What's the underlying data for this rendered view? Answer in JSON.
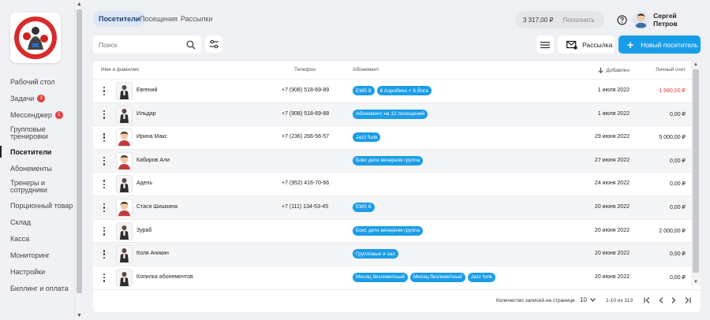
{
  "sidebar": {
    "items": [
      {
        "label": "Рабочий стол"
      },
      {
        "label": "Задачи",
        "badge": "3"
      },
      {
        "label": "Мессенджер",
        "badge": "1"
      },
      {
        "label": "Групповые тренировки"
      },
      {
        "label": "Посетители",
        "active": true
      },
      {
        "label": "Абонементы"
      },
      {
        "label": "Тренеры и сотрудники"
      },
      {
        "label": "Порционный товар"
      },
      {
        "label": "Склад"
      },
      {
        "label": "Касса"
      },
      {
        "label": "Мониторинг"
      },
      {
        "label": "Настройки"
      },
      {
        "label": "Биллинг и оплата"
      }
    ]
  },
  "topbar": {
    "tabs": [
      {
        "label": "Посетители",
        "active": true
      },
      {
        "label": "Посещения"
      },
      {
        "label": "Рассылки"
      }
    ],
    "balance": "3 317,00 ₽",
    "replenish_label": "Пополнить",
    "user_name": "Сергей Петров"
  },
  "toolbar": {
    "search_placeholder": "Поиск",
    "mailing_label": "Рассылка",
    "new_visitor_label": "Новый посетитель"
  },
  "table": {
    "columns": {
      "name": "Имя и фамилия",
      "phone": "Телефон",
      "subscription": "Абонемент",
      "added": "Добавлен",
      "balance": "Личный счет"
    },
    "rows": [
      {
        "name": "Евгений",
        "avatar": "photo",
        "phone": "+7 (908) 518-69-89",
        "subs": [
          "EMS 8",
          "8 Аэробика + 8 Йога"
        ],
        "added": "1 июля 2022",
        "balance": "-1 980,00 ₽",
        "negative": true
      },
      {
        "name": "Ильдар",
        "avatar": "photo",
        "phone": "+7 (908) 518-69-88",
        "subs": [
          "Абонемент на 12 посещений"
        ],
        "added": "1 июля 2022",
        "balance": "0,00 ₽"
      },
      {
        "name": "Ирина Макс",
        "avatar": "cartoon",
        "phone": "+7 (236) 266-56-57",
        "subs": [
          "Jazz funk"
        ],
        "added": "29 июня 2022",
        "balance": "5 000,00 ₽"
      },
      {
        "name": "Кабиров Али",
        "avatar": "cartoon",
        "phone": "",
        "subs": [
          "Бокс дети вечерняя группа"
        ],
        "added": "27 июня 2022",
        "balance": "0,00 ₽"
      },
      {
        "name": "Адель",
        "avatar": "photo",
        "phone": "+7 (952) 416-70-66",
        "subs": [],
        "added": "24 июня 2022",
        "balance": "0,00 ₽"
      },
      {
        "name": "Стася Шишкина",
        "avatar": "cartoon",
        "phone": "+7 (111) 134-53-45",
        "subs": [
          "EMS 8"
        ],
        "added": "20 июня 2022",
        "balance": "0,00 ₽"
      },
      {
        "name": "Зураб",
        "avatar": "photo",
        "phone": "",
        "subs": [
          "Бокс дети вечерняя группа"
        ],
        "added": "20 июня 2022",
        "balance": "2 000,00 ₽"
      },
      {
        "name": "Коля Аникин",
        "avatar": "photo",
        "phone": "",
        "subs": [
          "Групповые и зал"
        ],
        "added": "20 июня 2022",
        "balance": "0,00 ₽"
      },
      {
        "name": "Копилка абонементов",
        "avatar": "photo",
        "phone": "",
        "subs": [
          "Месяц безлимитный",
          "Месяц безлимитный",
          "Jazz funk"
        ],
        "added": "20 июня 2022",
        "balance": "0,00 ₽"
      }
    ]
  },
  "pagination": {
    "label": "Количество записей на странице",
    "per_page": "10",
    "range": "1-10 из 313"
  },
  "colors": {
    "accent": "#1a9de8",
    "negative": "#e53e3e",
    "badge": "#e53e3e"
  }
}
